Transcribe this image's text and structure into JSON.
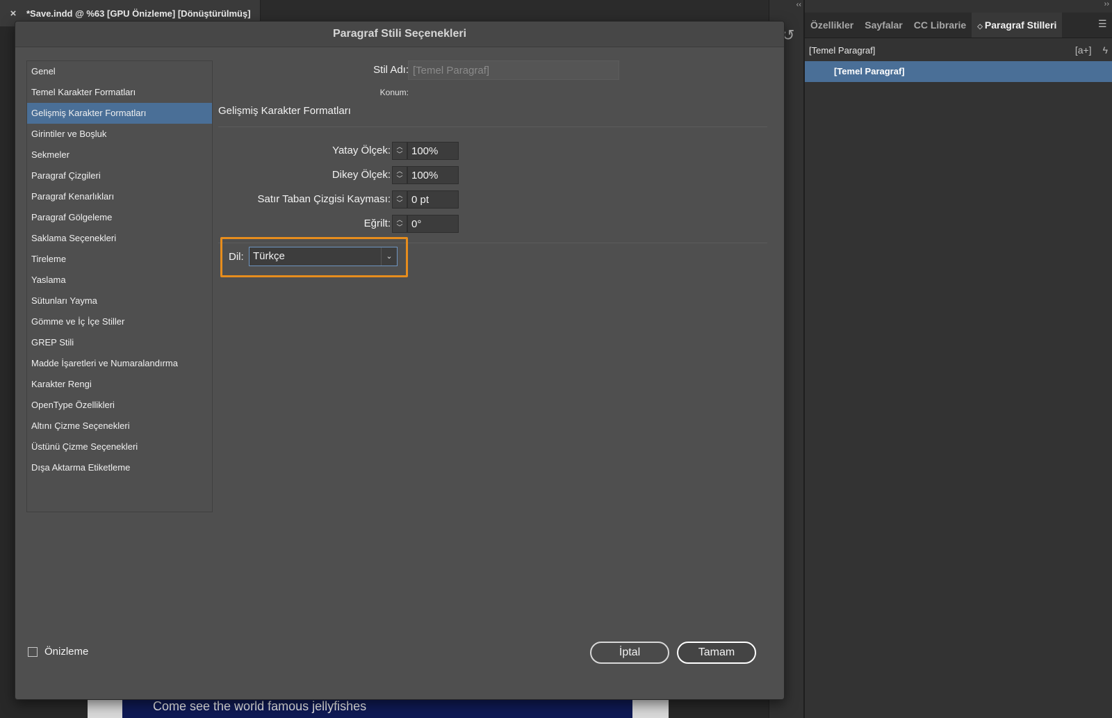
{
  "document_tab": {
    "close": "×",
    "title": "*Save.indd @ %63 [GPU Önizleme] [Dönüştürülmüş]"
  },
  "background": {
    "caption": "Come see the world famous jellyfishes"
  },
  "panel": {
    "collapse_left": "‹‹",
    "collapse_right": "››",
    "tabs": [
      "Özellikler",
      "Sayfalar",
      "CC Librarie",
      "Paragraf Stilleri"
    ],
    "active_tab": 3,
    "menu_icon": "hamburger-menu-icon",
    "current_style": "[Temel Paragraf]",
    "selected_style": "[Temel Paragraf]",
    "new_style_icon": "[a+]",
    "quick_apply_icon": "lightning-icon"
  },
  "dialog": {
    "title": "Paragraf Stili Seçenekleri",
    "sidebar": [
      "Genel",
      "Temel Karakter Formatları",
      "Gelişmiş Karakter Formatları",
      "Girintiler ve Boşluk",
      "Sekmeler",
      "Paragraf Çizgileri",
      "Paragraf Kenarlıkları",
      "Paragraf Gölgeleme",
      "Saklama Seçenekleri",
      "Tireleme",
      "Yaslama",
      "Sütunları Yayma",
      "Gömme ve İç İçe Stiller",
      "GREP Stili",
      "Madde İşaretleri ve Numaralandırma",
      "Karakter Rengi",
      "OpenType Özellikleri",
      "Altını Çizme Seçenekleri",
      "Üstünü Çizme Seçenekleri",
      "Dışa Aktarma Etiketleme"
    ],
    "selected_index": 2,
    "style_name_label": "Stil Adı:",
    "style_name_value": "[Temel Paragraf]",
    "location_label": "Konum:",
    "section_title": "Gelişmiş Karakter Formatları",
    "fields": [
      {
        "label": "Yatay Ölçek:",
        "value": "100%"
      },
      {
        "label": "Dikey Ölçek:",
        "value": "100%"
      },
      {
        "label": "Satır Taban Çizgisi Kayması:",
        "value": "0 pt"
      },
      {
        "label": "Eğrilt:",
        "value": "0°"
      }
    ],
    "language_label": "Dil:",
    "language_value": "Türkçe",
    "highlight_color": "#e78d1d",
    "preview_label": "Önizleme",
    "cancel_label": "İptal",
    "ok_label": "Tamam"
  }
}
